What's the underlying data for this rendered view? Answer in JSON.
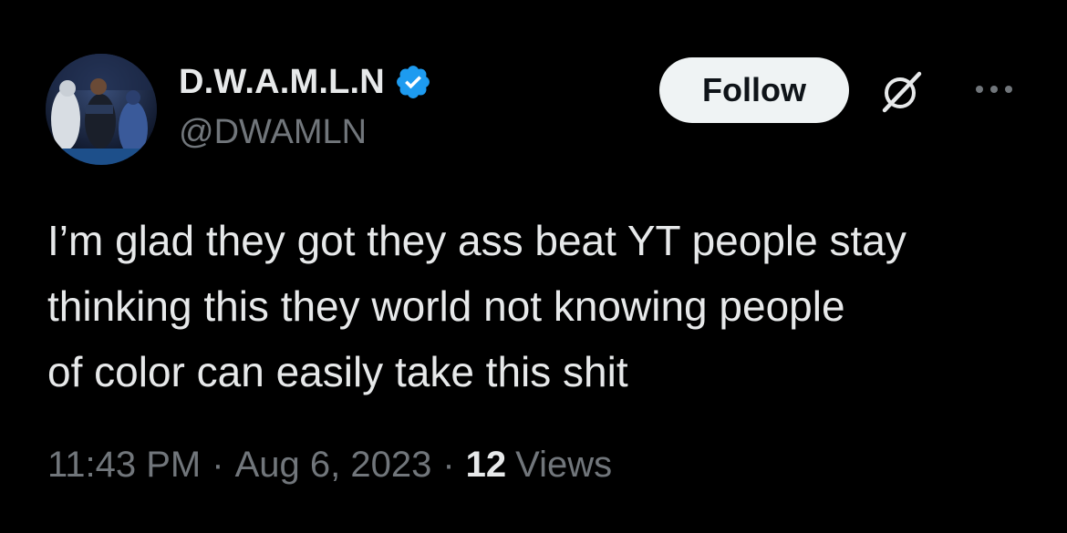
{
  "user": {
    "display_name": "D.W.A.M.L.N",
    "handle": "@DWAMLN",
    "verified": true,
    "verified_color": "#1d9bf0"
  },
  "actions": {
    "follow_label": "Follow",
    "grok_icon": "grok-icon",
    "more_icon": "more-dots-icon"
  },
  "tweet": {
    "text": "I’m glad they got they ass beat YT people stay\nthinking this they world not knowing people\nof color can easily take this shit"
  },
  "meta": {
    "time": "11:43 PM",
    "separator": "·",
    "date": "Aug 6, 2023",
    "views_count": "12",
    "views_label": "Views"
  },
  "colors": {
    "background": "#000000",
    "primary_text": "#e7e9ea",
    "secondary_text": "#71767b",
    "button_bg": "#eff3f4"
  }
}
